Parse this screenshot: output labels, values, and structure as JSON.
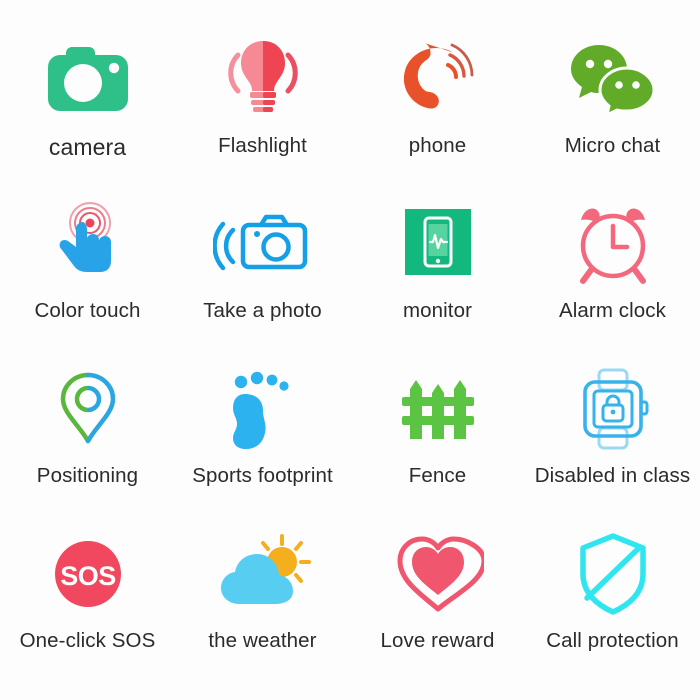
{
  "page": {
    "background_color": "#fdfdfd",
    "layout": "4x4 icon grid",
    "label_color": "#2b2b2b"
  },
  "colors": {
    "camera_green": "#2fc08a",
    "flashlight_pink_light": "#f58a95",
    "flashlight_red": "#ef4452",
    "phone_orange": "#e8522a",
    "wechat_green": "#61ab28",
    "touch_blue": "#29a3e8",
    "touch_red": "#e8465a",
    "photo_blue": "#159fe6",
    "monitor_green": "#13b87e",
    "alarm_pink": "#f4687d",
    "pin_green": "#5ab63c",
    "pin_blue": "#2ba6e0",
    "foot_blue": "#2bb2ef",
    "fence_green": "#5cc443",
    "watch_blue": "#36b3ea",
    "sos_red": "#f1485f",
    "cloud_blue": "#57cdf2",
    "sun_orange": "#f5ae1e",
    "heart_red": "#f0566e",
    "shield_cyan": "#2fe6ef"
  },
  "items": [
    {
      "label": "camera",
      "icon": "camera-icon"
    },
    {
      "label": "Flashlight",
      "icon": "flashlight-icon"
    },
    {
      "label": "phone",
      "icon": "phone-call-icon"
    },
    {
      "label": "Micro chat",
      "icon": "wechat-icon"
    },
    {
      "label": "Color touch",
      "icon": "color-touch-icon"
    },
    {
      "label": "Take a photo",
      "icon": "take-photo-icon"
    },
    {
      "label": "monitor",
      "icon": "monitor-icon"
    },
    {
      "label": "Alarm clock",
      "icon": "alarm-clock-icon"
    },
    {
      "label": "Positioning",
      "icon": "map-pin-icon"
    },
    {
      "label": "Sports footprint",
      "icon": "footprint-icon"
    },
    {
      "label": "Fence",
      "icon": "fence-icon"
    },
    {
      "label": "Disabled in class",
      "icon": "locked-watch-icon"
    },
    {
      "label": "One-click SOS",
      "icon": "sos-icon"
    },
    {
      "label": "the weather",
      "icon": "weather-cloud-sun-icon"
    },
    {
      "label": "Love reward",
      "icon": "heart-icon"
    },
    {
      "label": "Call protection",
      "icon": "shield-icon"
    }
  ]
}
